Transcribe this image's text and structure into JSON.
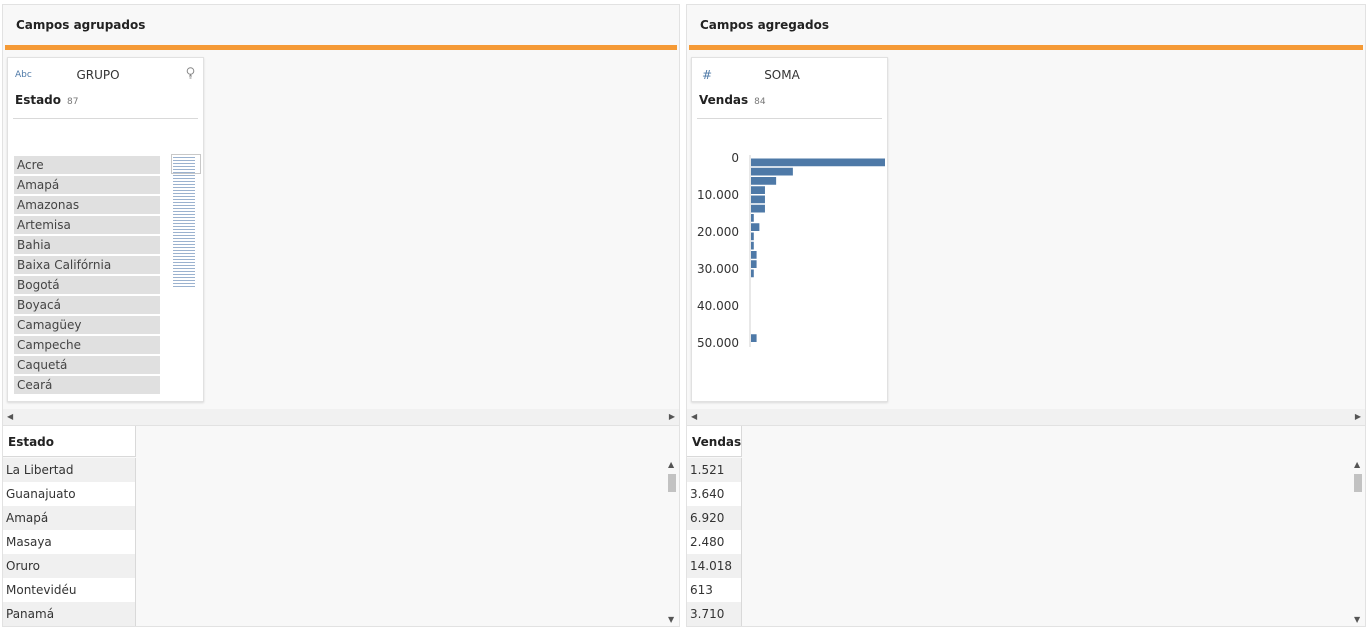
{
  "left_pane": {
    "title": "Campos agrupados",
    "card": {
      "type_icon": "Abc",
      "aggregation": "GRUPO",
      "field_name": "Estado",
      "count": "87",
      "values": [
        "Acre",
        "Amapá",
        "Amazonas",
        "Artemisa",
        "Bahia",
        "Baixa Califórnia",
        "Bogotá",
        "Boyacá",
        "Camagüey",
        "Campeche",
        "Caquetá",
        "Ceará"
      ]
    },
    "table": {
      "header": "Estado",
      "rows": [
        "La Libertad",
        "Guanajuato",
        "Amapá",
        "Masaya",
        "Oruro",
        "Montevidéu",
        "Panamá"
      ]
    }
  },
  "right_pane": {
    "title": "Campos agregados",
    "card": {
      "type_icon": "#",
      "aggregation": "SOMA",
      "field_name": "Vendas",
      "count": "84"
    },
    "table": {
      "header": "Vendas",
      "rows": [
        "1.521",
        "3.640",
        "6.920",
        "2.480",
        "14.018",
        "613",
        "3.710"
      ]
    }
  },
  "icons": {
    "bulb": "lightbulb-icon",
    "scroll_left": "scroll-left-icon",
    "scroll_right": "scroll-right-icon"
  },
  "colors": {
    "accent": "#f59a36",
    "bar": "#4e79a7"
  },
  "chart_data": {
    "type": "bar",
    "orientation": "horizontal",
    "ytick_labels": [
      "0",
      "10.000",
      "20.000",
      "30.000",
      "40.000",
      "50.000"
    ],
    "yticks": [
      0,
      10000,
      20000,
      30000,
      40000,
      50000
    ],
    "bin_size": 2500,
    "bins": [
      {
        "start": 0,
        "count": 48
      },
      {
        "start": 2500,
        "count": 15
      },
      {
        "start": 5000,
        "count": 9
      },
      {
        "start": 7500,
        "count": 5
      },
      {
        "start": 10000,
        "count": 5
      },
      {
        "start": 12500,
        "count": 5
      },
      {
        "start": 15000,
        "count": 1
      },
      {
        "start": 17500,
        "count": 3
      },
      {
        "start": 20000,
        "count": 1
      },
      {
        "start": 22500,
        "count": 1
      },
      {
        "start": 25000,
        "count": 2
      },
      {
        "start": 27500,
        "count": 2
      },
      {
        "start": 30000,
        "count": 1
      },
      {
        "start": 47500,
        "count": 2
      }
    ],
    "ylim": [
      0,
      50000
    ]
  }
}
